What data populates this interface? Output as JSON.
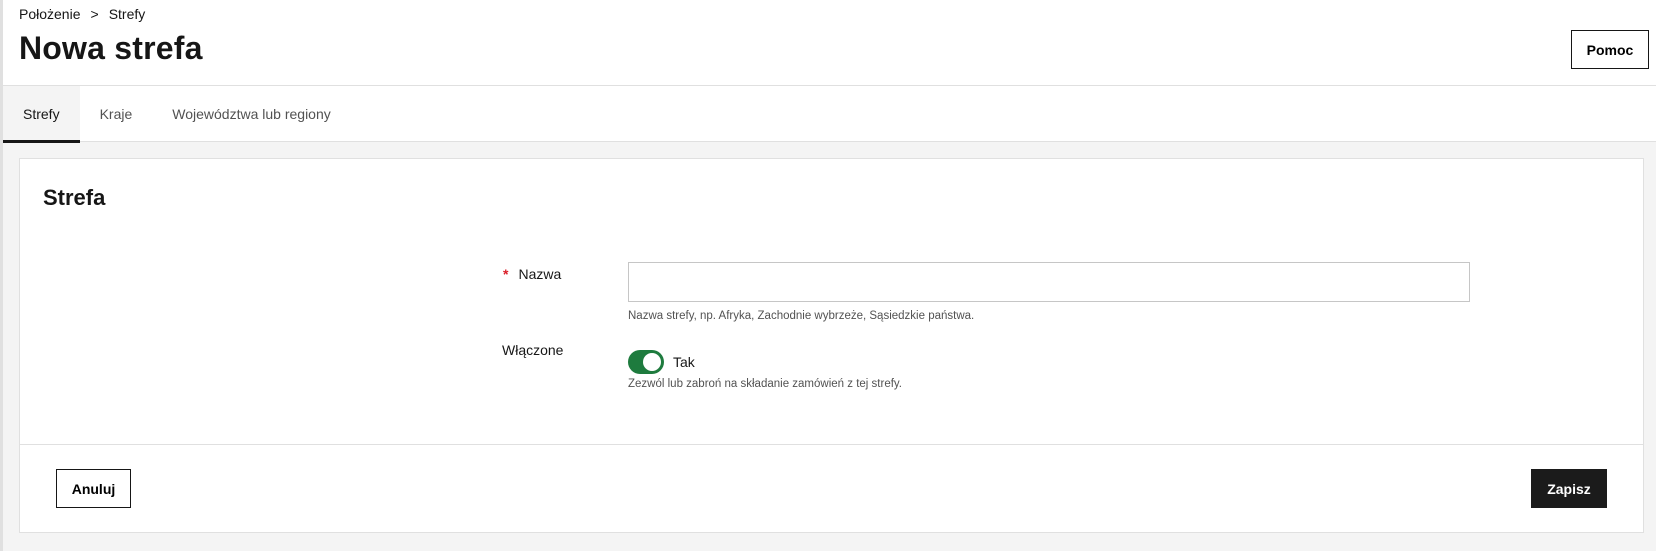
{
  "breadcrumb": {
    "items": [
      "Położenie",
      "Strefy"
    ],
    "separator": ">"
  },
  "header": {
    "title": "Nowa strefa",
    "help_label": "Pomoc"
  },
  "tabs": [
    {
      "label": "Strefy",
      "active": true
    },
    {
      "label": "Kraje",
      "active": false
    },
    {
      "label": "Województwa lub regiony",
      "active": false
    }
  ],
  "form": {
    "section_title": "Strefa",
    "name": {
      "label": "Nazwa",
      "required_marker": "*",
      "value": "",
      "helper": "Nazwa strefy, np. Afryka, Zachodnie wybrzeże, Sąsiedzkie państwa."
    },
    "enabled": {
      "label": "Włączone",
      "state": true,
      "state_label": "Tak",
      "helper": "Zezwól lub zabroń na składanie zamówień z tej strefy."
    }
  },
  "actions": {
    "cancel_label": "Anuluj",
    "save_label": "Zapisz"
  },
  "colors": {
    "toggle_on": "#1e7b3e",
    "primary_button": "#1b1b1b",
    "required": "#da1e28"
  }
}
